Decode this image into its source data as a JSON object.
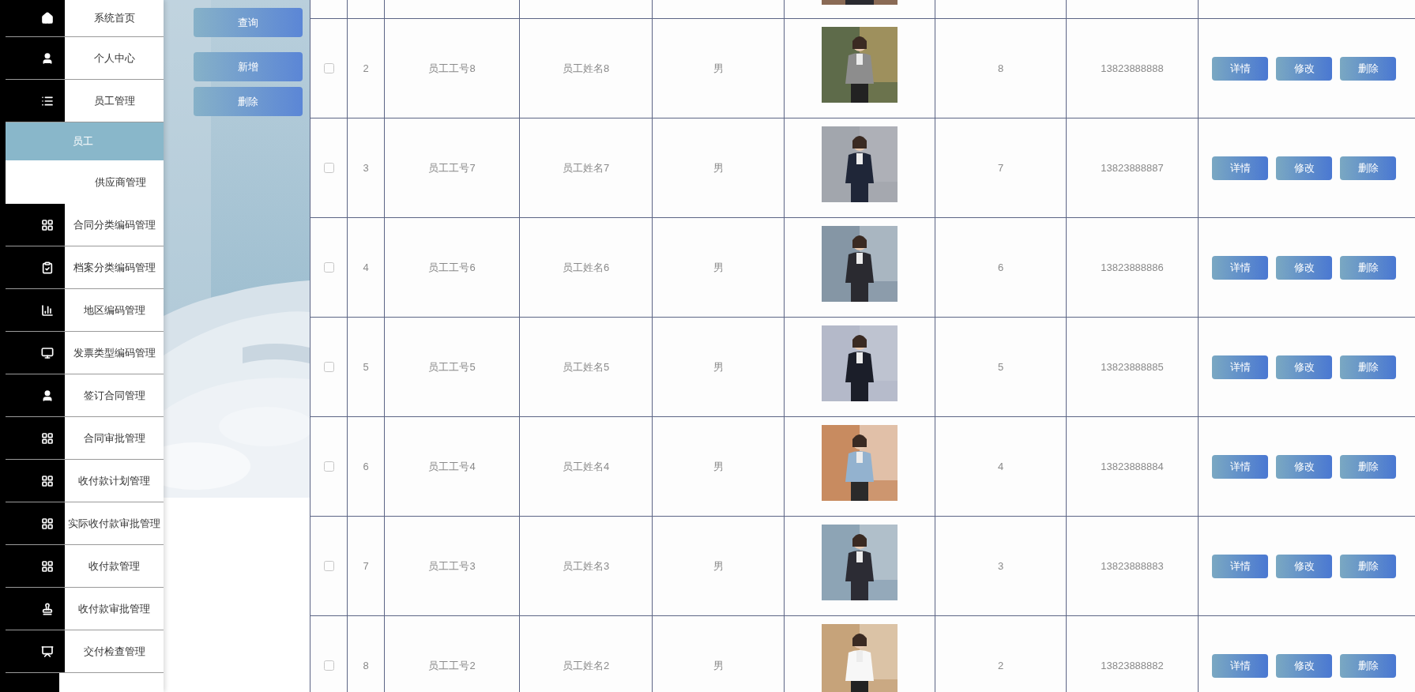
{
  "sidebar": {
    "items": [
      {
        "label": "系统首页"
      },
      {
        "label": "个人中心"
      },
      {
        "label": "员工管理",
        "children": [
          {
            "label": "员工",
            "selected": true
          },
          {
            "label": "供应商管理",
            "selected": false
          }
        ]
      },
      {
        "label": "合同分类编码管理"
      },
      {
        "label": "档案分类编码管理"
      },
      {
        "label": "地区编码管理"
      },
      {
        "label": "发票类型编码管理"
      },
      {
        "label": "签订合同管理"
      },
      {
        "label": "合同审批管理"
      },
      {
        "label": "收付款计划管理"
      },
      {
        "label": "实际收付款审批管理"
      },
      {
        "label": "收付款管理"
      },
      {
        "label": "收付款审批管理"
      },
      {
        "label": "交付检查管理"
      }
    ]
  },
  "toolbar": {
    "search_button": "查询",
    "buttons": [
      "新增",
      "删除"
    ]
  },
  "table": {
    "rows": [
      {
        "checked": false,
        "index": "2",
        "emp_no": "员工工号8",
        "name": "员工姓名8",
        "gender": "男",
        "column_7": "8",
        "phone": "13823888888",
        "actions": [
          "详情",
          "修改",
          "删除"
        ]
      },
      {
        "checked": false,
        "index": "3",
        "emp_no": "员工工号7",
        "name": "员工姓名7",
        "gender": "男",
        "column_7": "7",
        "phone": "13823888887",
        "actions": [
          "详情",
          "修改",
          "删除"
        ]
      },
      {
        "checked": false,
        "index": "4",
        "emp_no": "员工工号6",
        "name": "员工姓名6",
        "gender": "男",
        "column_7": "6",
        "phone": "13823888886",
        "actions": [
          "详情",
          "修改",
          "删除"
        ]
      },
      {
        "checked": false,
        "index": "5",
        "emp_no": "员工工号5",
        "name": "员工姓名5",
        "gender": "男",
        "column_7": "5",
        "phone": "13823888885",
        "actions": [
          "详情",
          "修改",
          "删除"
        ]
      },
      {
        "checked": false,
        "index": "6",
        "emp_no": "员工工号4",
        "name": "员工姓名4",
        "gender": "男",
        "column_7": "4",
        "phone": "13823888884",
        "actions": [
          "详情",
          "修改",
          "删除"
        ]
      },
      {
        "checked": false,
        "index": "7",
        "emp_no": "员工工号3",
        "name": "员工姓名3",
        "gender": "男",
        "column_7": "3",
        "phone": "13823888883",
        "actions": [
          "详情",
          "修改",
          "删除"
        ]
      },
      {
        "checked": false,
        "index": "8",
        "emp_no": "员工工号2",
        "name": "员工姓名2",
        "gender": "男",
        "column_7": "2",
        "phone": "13823888882",
        "actions": [
          "详情",
          "修改",
          "删除"
        ]
      }
    ]
  }
}
